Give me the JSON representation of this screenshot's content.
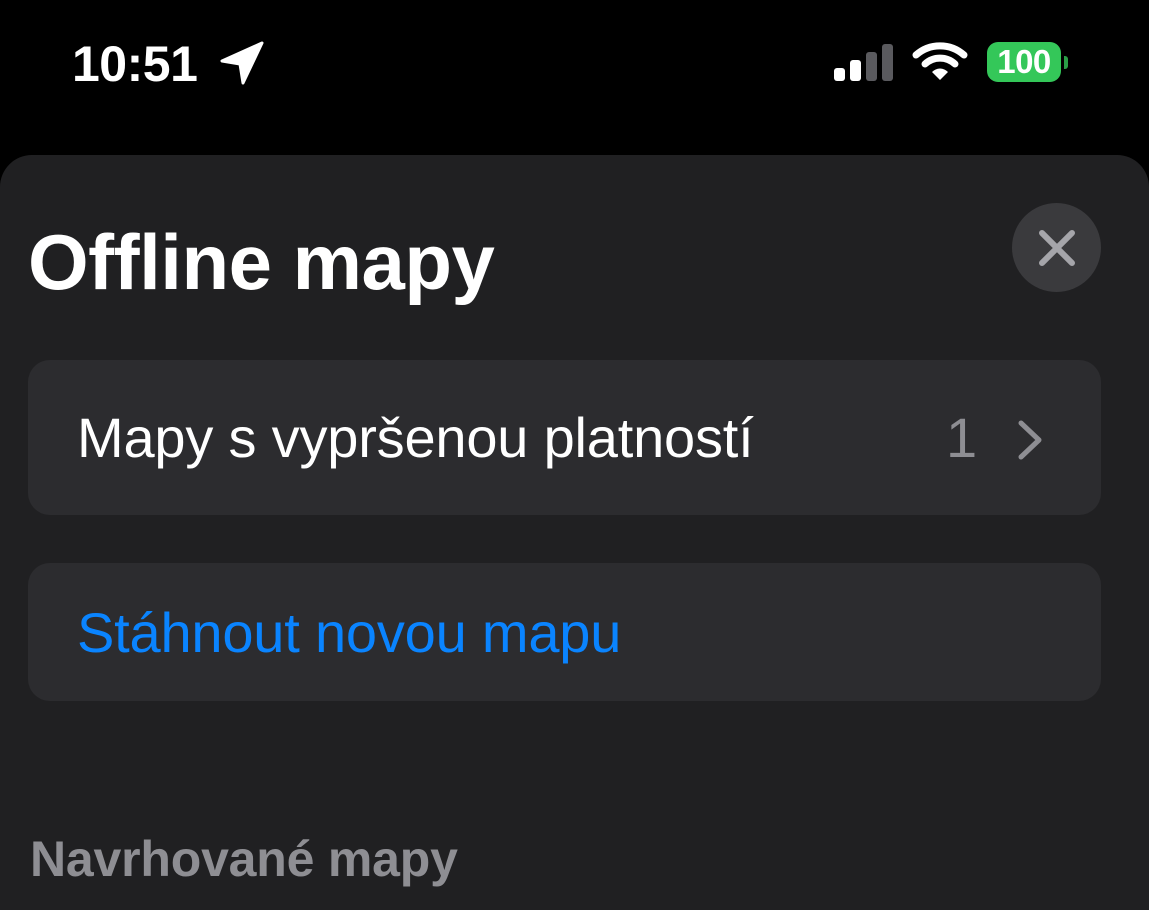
{
  "status_bar": {
    "time": "10:51",
    "location_icon": "location-arrow-icon",
    "signal_icon": "cellular-signal-icon",
    "wifi_icon": "wifi-icon",
    "battery_level": "100",
    "battery_color": "#34c759"
  },
  "sheet": {
    "title": "Offline mapy",
    "close_icon": "close-icon",
    "expired_maps": {
      "label": "Mapy s vypršenou platností",
      "count": "1",
      "chevron_icon": "chevron-right-icon"
    },
    "download": {
      "label": "Stáhnout novou mapu",
      "color": "#0a84ff"
    },
    "suggested_header": "Navrhované mapy"
  }
}
